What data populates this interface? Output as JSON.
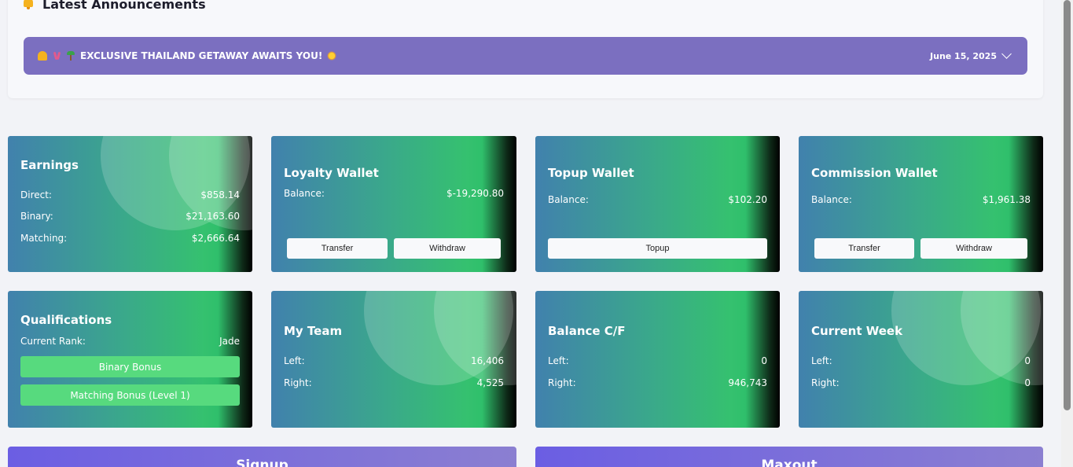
{
  "announcements": {
    "title": "Latest Announcements",
    "item": {
      "text": "EXCLUSIVE THAILAND GETAWAY AWAITS YOU!",
      "date": "June 15, 2025"
    }
  },
  "earnings": {
    "title": "Earnings",
    "rows": [
      {
        "label": "Direct:",
        "value": "$858.14"
      },
      {
        "label": "Binary:",
        "value": "$21,163.60"
      },
      {
        "label": "Matching:",
        "value": "$2,666.64"
      }
    ]
  },
  "loyalty_wallet": {
    "title": "Loyalty Wallet",
    "balance_label": "Balance:",
    "balance_value": "$-19,290.80",
    "transfer_label": "Transfer",
    "withdraw_label": "Withdraw"
  },
  "topup_wallet": {
    "title": "Topup Wallet",
    "balance_label": "Balance:",
    "balance_value": "$102.20",
    "topup_label": "Topup"
  },
  "commission_wallet": {
    "title": "Commission Wallet",
    "balance_label": "Balance:",
    "balance_value": "$1,961.38",
    "transfer_label": "Transfer",
    "withdraw_label": "Withdraw"
  },
  "qualifications": {
    "title": "Qualifications",
    "rank_label": "Current Rank:",
    "rank_value": "Jade",
    "badges": [
      "Binary Bonus",
      "Matching Bonus (Level 1)"
    ]
  },
  "my_team": {
    "title": "My Team",
    "left_label": "Left:",
    "left_value": "16,406",
    "right_label": "Right:",
    "right_value": "4,525"
  },
  "balance_cf": {
    "title": "Balance C/F",
    "left_label": "Left:",
    "left_value": "0",
    "right_label": "Right:",
    "right_value": "946,743"
  },
  "current_week": {
    "title": "Current Week",
    "left_label": "Left:",
    "left_value": "0",
    "right_label": "Right:",
    "right_value": "0"
  },
  "bottom": {
    "signup_label": "Signup",
    "maxout_label": "Maxout"
  },
  "colors": {
    "announce_bar": "#7b6fc0",
    "badge_green": "#57da7e",
    "card_gradient_start": "#4181ad",
    "card_gradient_mid": "#35c16f"
  }
}
